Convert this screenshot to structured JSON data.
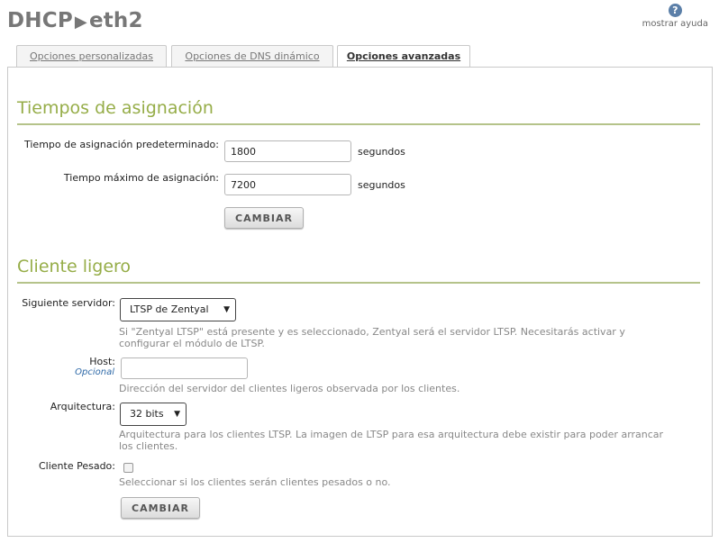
{
  "header": {
    "title_part1": "DHCP",
    "arrow": "▶",
    "title_part2": "eth2",
    "help_label": "mostrar ayuda",
    "help_icon": "question-mark-icon"
  },
  "tabs": [
    {
      "label": "Opciones personalizadas",
      "active": false
    },
    {
      "label": "Opciones de DNS dinámico",
      "active": false
    },
    {
      "label": "Opciones avanzadas",
      "active": true
    }
  ],
  "lease": {
    "section_title": "Tiempos de asignación",
    "default_label": "Tiempo de asignación predeterminado:",
    "default_value": "1800",
    "default_unit": "segundos",
    "max_label": "Tiempo máximo de asignación:",
    "max_value": "7200",
    "max_unit": "segundos",
    "button": "CAMBIAR"
  },
  "thin_client": {
    "section_title": "Cliente ligero",
    "next_server_label": "Siguiente servidor:",
    "next_server_value": "LTSP de Zentyal",
    "next_server_help_1": "Si \"Zentyal LTSP\" está presente y es seleccionado, Zentyal será el servidor LTSP. Necesitarás activar y",
    "next_server_help_2": "configurar el módulo de LTSP.",
    "host_label": "Host:",
    "host_optional": "Opcional",
    "host_value": "",
    "host_help": "Dirección del servidor del clientes ligeros observada por los clientes.",
    "arch_label": "Arquitectura:",
    "arch_value": "32 bits",
    "arch_help_1": "Arquitectura para los clientes LTSP. La imagen de LTSP para esa arquitectura debe existir para poder arrancar",
    "arch_help_2": "los clientes.",
    "heavy_label": "Cliente Pesado:",
    "heavy_checked": false,
    "heavy_help": "Seleccionar si los clientes serán clientes pesados o no.",
    "button": "CAMBIAR"
  },
  "colors": {
    "accent": "#96ad48",
    "rule": "#b5c38a",
    "link": "#2f6aa8"
  }
}
